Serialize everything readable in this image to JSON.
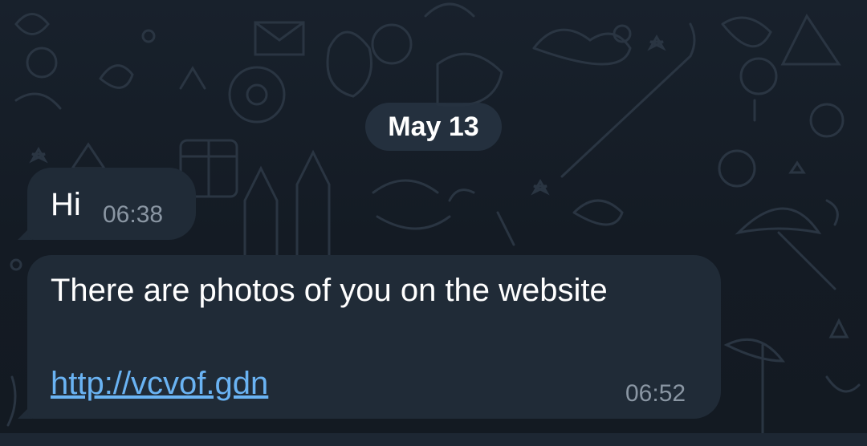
{
  "date_separator": "May 13",
  "messages": [
    {
      "text": "Hi",
      "time": "06:38"
    },
    {
      "text": "There are photos of you on the website",
      "link": "http://vcvof.gdn",
      "time": "06:52"
    }
  ],
  "colors": {
    "background": "#151c26",
    "bubble": "#202b37",
    "text": "#ffffff",
    "time": "#8a96a3",
    "link": "#6ab3f3"
  }
}
